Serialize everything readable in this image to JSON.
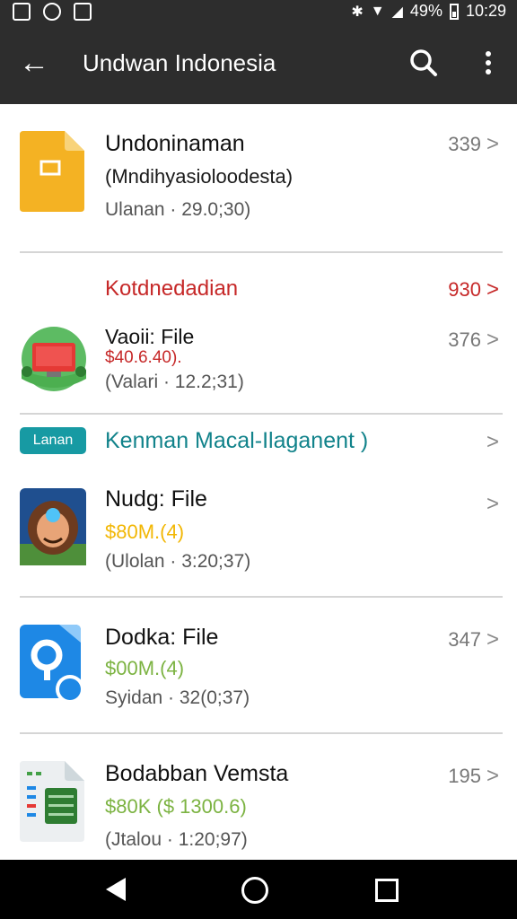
{
  "status_bar": {
    "battery": "49%",
    "time": "10:29",
    "icons": [
      "image-icon",
      "sync-icon",
      "download-icon",
      "bluetooth-icon",
      "wifi-icon",
      "signal-icon",
      "battery-icon"
    ]
  },
  "app_bar": {
    "title": "Undwan Indonesia",
    "icons": [
      "back-arrow-icon",
      "search-icon",
      "more-vert-icon"
    ]
  },
  "items": [
    {
      "title": "Undoninaman",
      "subtitle": "(Mndihyasioloodesta)",
      "meta": "Ulanan · 29.0;30)",
      "count": "339",
      "icon": "document-icon"
    },
    {
      "title": "Kotdnedadian",
      "count": "930",
      "icon": null
    },
    {
      "title": "Vaoii: File",
      "subtitle": "$40.6.40).",
      "meta": "(Valari · 12.2;31)",
      "count": "376",
      "icon": "computer-icon"
    },
    {
      "title": "Nudg: File",
      "subtitle": "$80M.(4)",
      "meta": "(Ulolan · 3:20;37)",
      "count": "",
      "icon": "avatar-icon"
    },
    {
      "title": "Dodka: File",
      "subtitle": "$00M.(4)",
      "meta": "Syidan · 32(0;37)",
      "count": "347",
      "icon": "search-app-icon"
    },
    {
      "title": "Bodabban Vemsta",
      "subtitle": "$80K ($ 1300.6)",
      "meta": "(Jtalou · 1:20;97)",
      "count": "195",
      "icon": "spreadsheet-icon"
    }
  ],
  "section": {
    "pill": "Lanan",
    "title": "Kenman Macal-Ilaganent )"
  },
  "chevron": ">",
  "nav_bar": {
    "icons": [
      "nav-back-icon",
      "nav-home-icon",
      "nav-recents-icon"
    ]
  },
  "colors": {
    "bar": "#2d2d2d",
    "accent_teal": "#179aa3",
    "red": "#c62828",
    "green": "#7cb342",
    "gold": "#f2b705"
  }
}
